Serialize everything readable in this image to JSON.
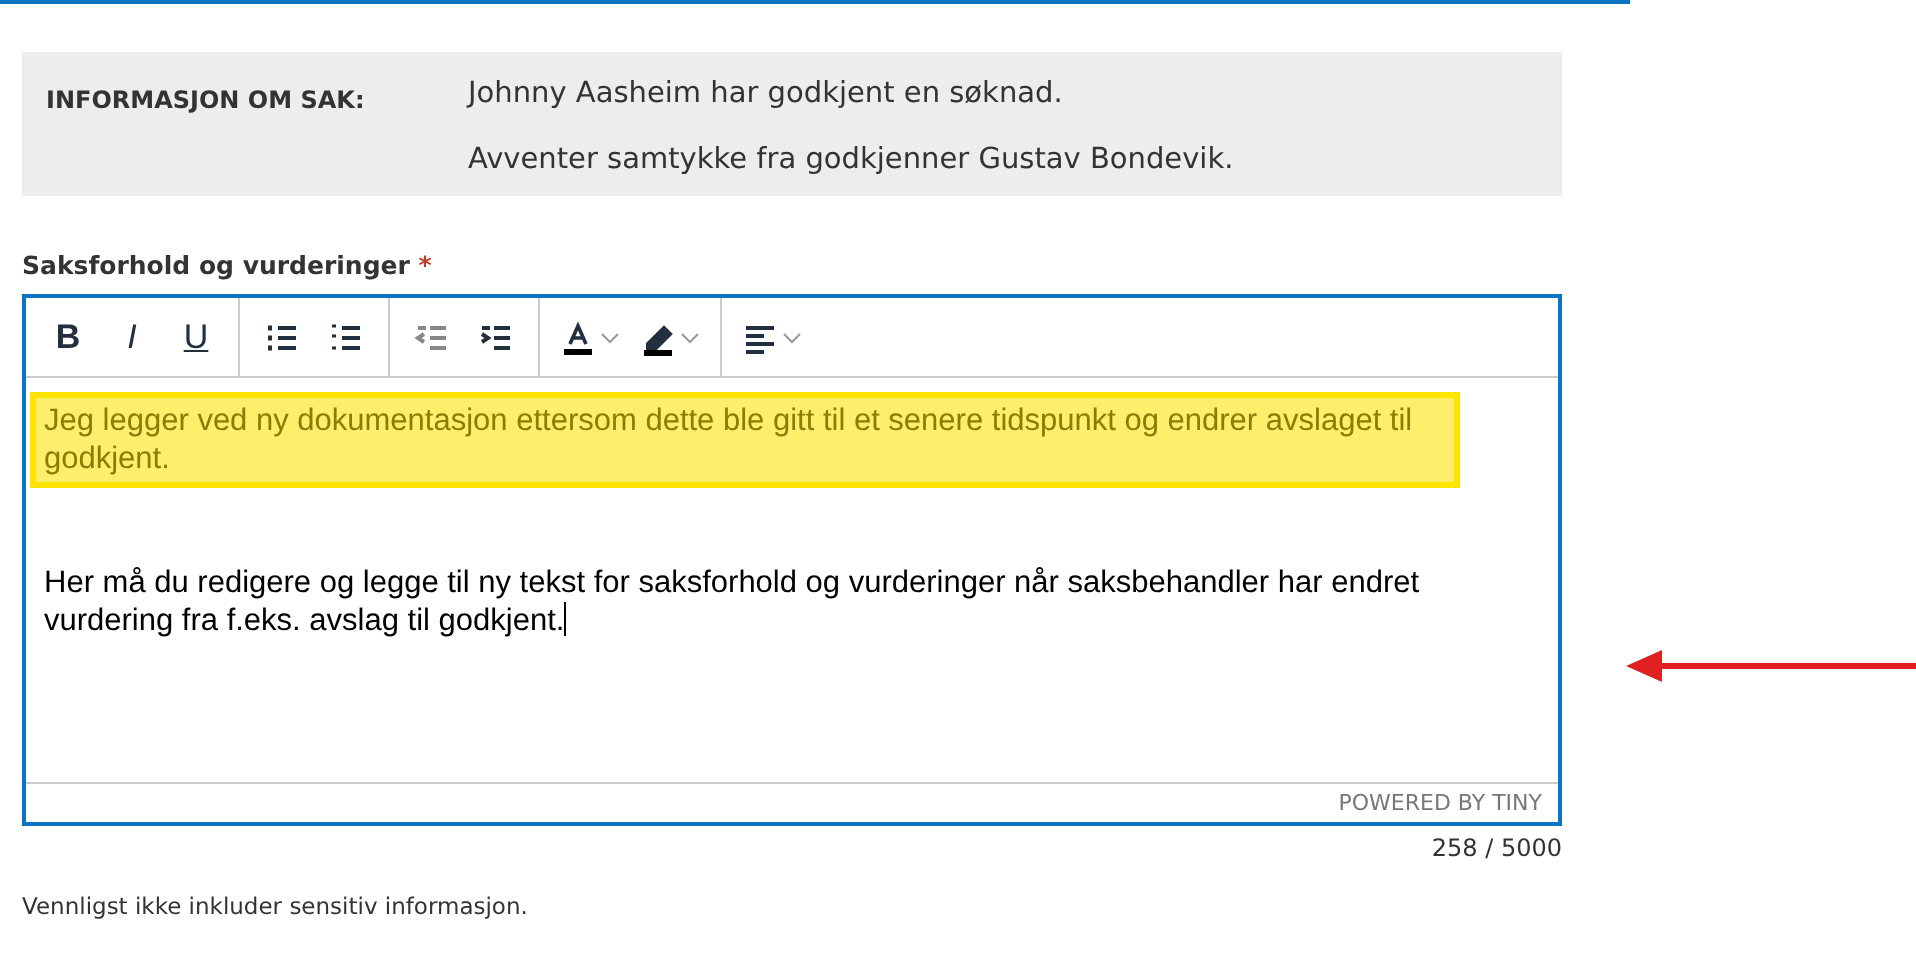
{
  "info": {
    "label": "INFORMASJON OM SAK:",
    "lines": [
      "Johnny Aasheim har godkjent en søknad.",
      "Avventer samtykke fra godkjenner Gustav Bondevik."
    ]
  },
  "field": {
    "label": "Saksforhold og vurderinger",
    "required_mark": "*"
  },
  "toolbar": {
    "format_buttons": [
      {
        "kind": "bold",
        "label": "B"
      },
      {
        "kind": "italic",
        "label": "I"
      },
      {
        "kind": "underline",
        "label": "U"
      }
    ]
  },
  "editor": {
    "paragraphs": [
      {
        "kind": "highlighted",
        "text": "Jeg legger ved ny dokumentasjon ettersom dette ble gitt til et senere tidspunkt og endrer avslaget til godkjent."
      },
      {
        "kind": "plain",
        "text": "Her må du redigere og legge til ny tekst for saksforhold og vurderinger når saksbehandler har endret vurdering fra f.eks. avslag til godkjent."
      }
    ],
    "branding": "POWERED BY TINY"
  },
  "counter": "258 / 5000",
  "hint": "Vennligst ikke inkluder sensitiv informasjon."
}
